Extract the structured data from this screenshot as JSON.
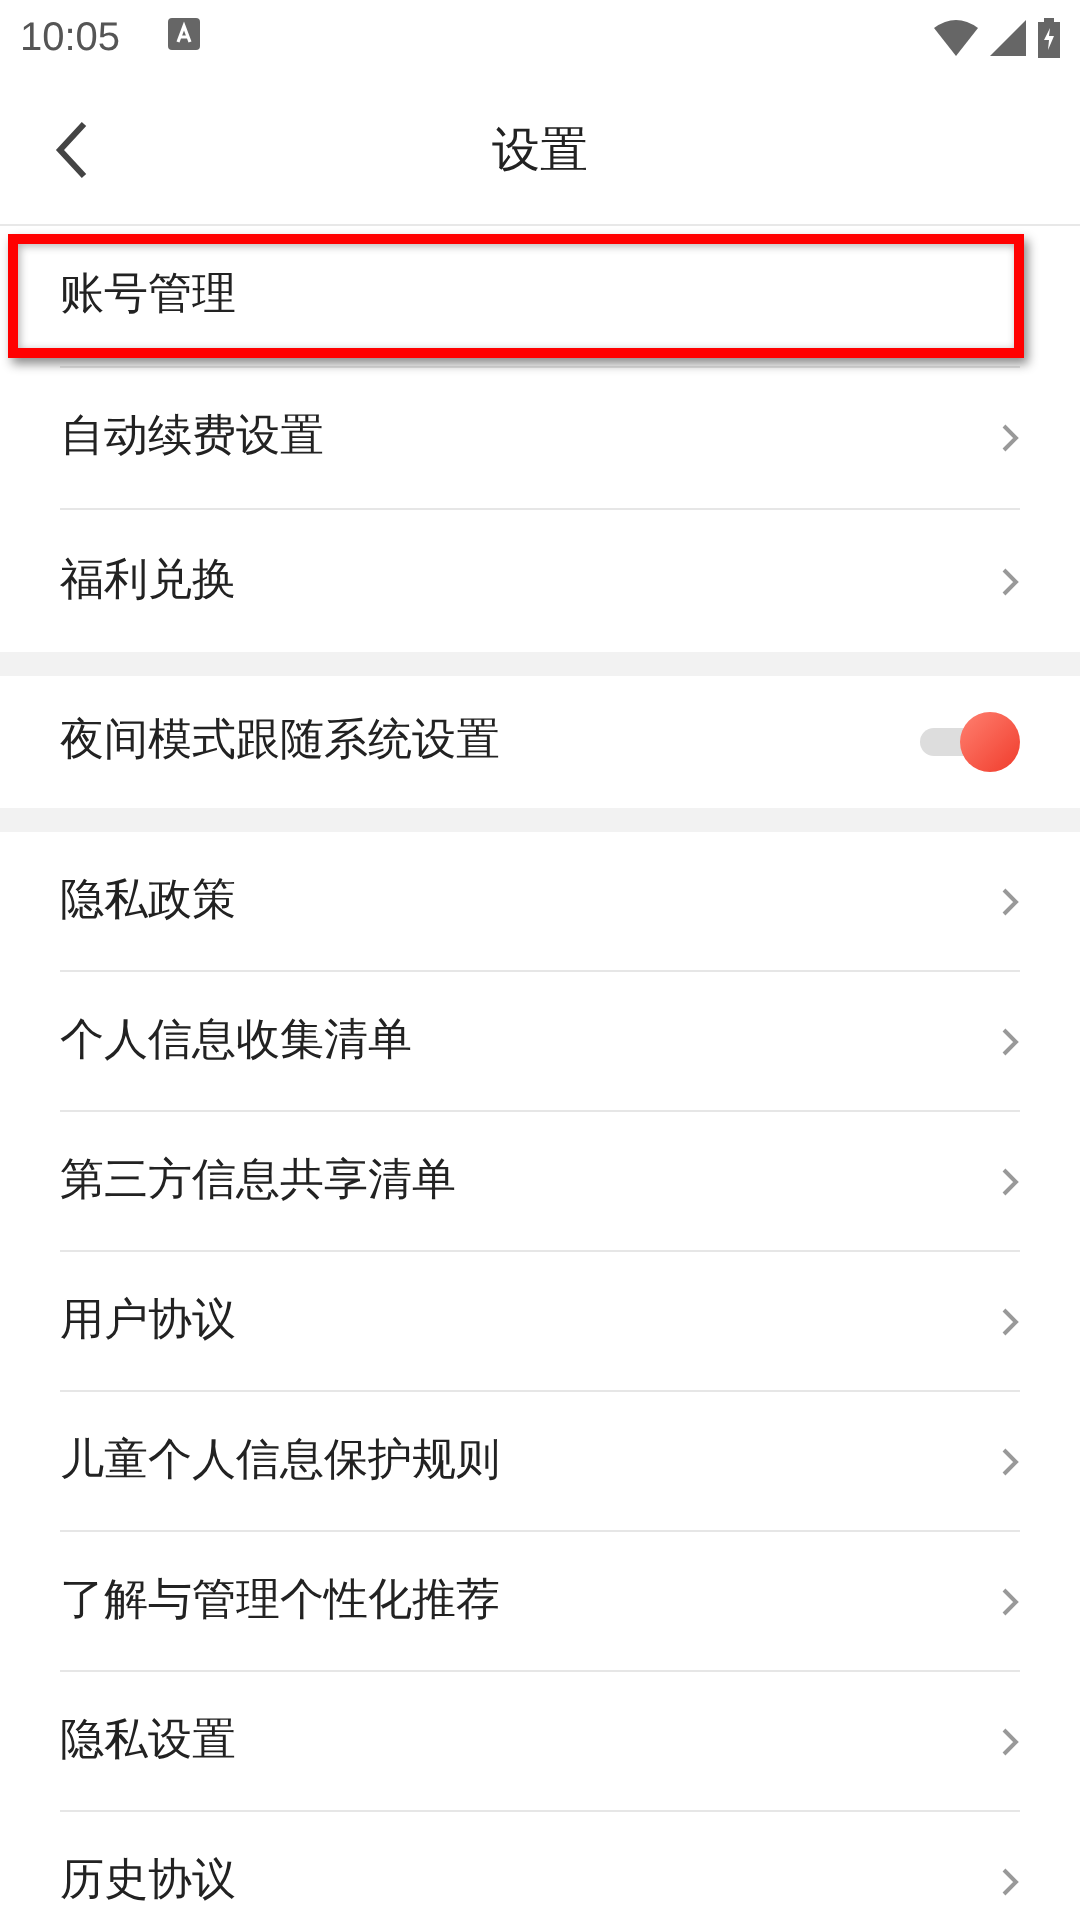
{
  "status_bar": {
    "time": "10:05"
  },
  "header": {
    "title": "设置"
  },
  "groups": [
    {
      "items": [
        {
          "label": "账号管理",
          "kind": "plain",
          "highlighted": true
        },
        {
          "label": "自动续费设置",
          "kind": "link",
          "highlighted": false
        },
        {
          "label": "福利兑换",
          "kind": "link",
          "highlighted": false
        }
      ]
    },
    {
      "items": [
        {
          "label": "夜间模式跟随系统设置",
          "kind": "toggle",
          "on": true,
          "highlighted": false
        }
      ]
    },
    {
      "items": [
        {
          "label": "隐私政策",
          "kind": "link",
          "highlighted": false
        },
        {
          "label": "个人信息收集清单",
          "kind": "link",
          "highlighted": false
        },
        {
          "label": "第三方信息共享清单",
          "kind": "link",
          "highlighted": false
        },
        {
          "label": "用户协议",
          "kind": "link",
          "highlighted": false
        },
        {
          "label": "儿童个人信息保护规则",
          "kind": "link",
          "highlighted": false
        },
        {
          "label": "了解与管理个性化推荐",
          "kind": "link",
          "highlighted": false
        },
        {
          "label": "隐私设置",
          "kind": "link",
          "highlighted": false
        },
        {
          "label": "历史协议",
          "kind": "link",
          "highlighted": false
        }
      ]
    }
  ]
}
